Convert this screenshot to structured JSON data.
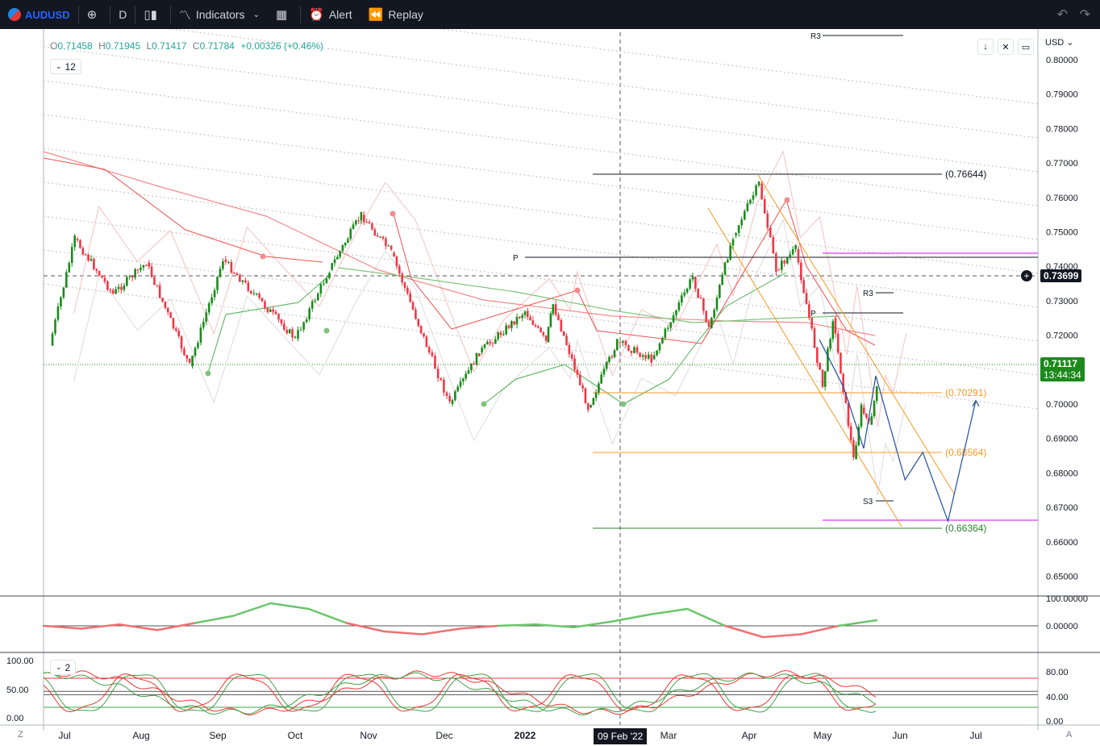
{
  "toolbar": {
    "symbol": "AUDUSD",
    "timeframe": "D",
    "indicators_label": "Indicators",
    "alert_label": "Alert",
    "replay_label": "Replay"
  },
  "legend": {
    "o_label": "O",
    "o": "0.71458",
    "h_label": "H",
    "h": "0.71945",
    "l_label": "L",
    "l": "0.71417",
    "c_label": "C",
    "c": "0.71784",
    "change": "+0.00326 (+0.46%)",
    "main_indicator_count": "12",
    "lower_indicator_count": "2"
  },
  "axis": {
    "currency": "USD",
    "price_ticks": [
      "0.80000",
      "0.79000",
      "0.78000",
      "0.77000",
      "0.76000",
      "0.75000",
      "0.74000",
      "0.73000",
      "0.72000",
      "0.71000",
      "0.70000",
      "0.69000",
      "0.68000",
      "0.67000",
      "0.66000",
      "0.65000"
    ],
    "osc1_ticks": [
      "100.00000",
      "0.00000"
    ],
    "osc2_right_ticks": [
      "80.00",
      "40.00",
      "0.00"
    ],
    "osc2_left_ticks": [
      "100.00",
      "50.00",
      "0.00"
    ],
    "time_labels": [
      "Jul",
      "Aug",
      "Sep",
      "Oct",
      "Nov",
      "Dec",
      "2022",
      "Mar",
      "Apr",
      "May",
      "Jun",
      "Jul"
    ],
    "left_corner": "Z",
    "right_corner": "A"
  },
  "tags": {
    "crosshair_price": "0.73699",
    "last_price": "0.71117",
    "countdown": "13:44:34",
    "crosshair_date": "09 Feb '22"
  },
  "colors": {
    "up": "#26a69a",
    "up_candle": "#1b8a1b",
    "down": "#f23645",
    "toolbar": "#131722",
    "fib": "#f59a23",
    "pivot": "#131722",
    "channel": "#c0c0c0",
    "forecast": "#1f4e9c",
    "magenta": "#d500f9"
  },
  "chart_data": {
    "type": "candlestick",
    "symbol": "AUDUSD",
    "timeframe": "D",
    "ylim": [
      0.645,
      0.802
    ],
    "price_levels": [
      {
        "label": "(0.76644)",
        "value": 0.76644
      },
      {
        "label": "(0.70291)",
        "value": 0.70291
      },
      {
        "label": "(0.68564)",
        "value": 0.68564
      },
      {
        "label": "(0.66364)",
        "value": 0.66364
      }
    ],
    "pivot_labels": [
      "P",
      "R3",
      "S3"
    ],
    "swing_points": [
      {
        "date": "Jun 25",
        "price": 0.717
      },
      {
        "date": "Jul 5",
        "price": 0.748
      },
      {
        "date": "Jul 20",
        "price": 0.732
      },
      {
        "date": "Aug 3",
        "price": 0.741
      },
      {
        "date": "Aug 20",
        "price": 0.711
      },
      {
        "date": "Sep 3",
        "price": 0.742
      },
      {
        "date": "Sep 15",
        "price": 0.732
      },
      {
        "date": "Oct 1",
        "price": 0.719
      },
      {
        "date": "Oct 15",
        "price": 0.739
      },
      {
        "date": "Oct 28",
        "price": 0.755
      },
      {
        "date": "Nov 10",
        "price": 0.744
      },
      {
        "date": "Nov 25",
        "price": 0.715
      },
      {
        "date": "Dec 3",
        "price": 0.7
      },
      {
        "date": "Dec 14",
        "price": 0.715
      },
      {
        "date": "Dec 31",
        "price": 0.727
      },
      {
        "date": "Jan 10",
        "price": 0.718
      },
      {
        "date": "Jan 13",
        "price": 0.729
      },
      {
        "date": "Jan 28",
        "price": 0.699
      },
      {
        "date": "Feb 10",
        "price": 0.718
      },
      {
        "date": "Feb 24",
        "price": 0.713
      },
      {
        "date": "Mar 10",
        "price": 0.737
      },
      {
        "date": "Mar 16",
        "price": 0.722
      },
      {
        "date": "Mar 25",
        "price": 0.749
      },
      {
        "date": "Apr 5",
        "price": 0.764
      },
      {
        "date": "Apr 12",
        "price": 0.739
      },
      {
        "date": "Apr 20",
        "price": 0.745
      },
      {
        "date": "May 1",
        "price": 0.705
      },
      {
        "date": "May 5",
        "price": 0.725
      },
      {
        "date": "May 13",
        "price": 0.684
      },
      {
        "date": "May 16",
        "price": 0.699
      },
      {
        "date": "May 19",
        "price": 0.694
      },
      {
        "date": "May 24",
        "price": 0.7111
      }
    ],
    "forecast_path": [
      {
        "date": "May 24",
        "price": 0.711
      },
      {
        "date": "Jun 3",
        "price": 0.678
      },
      {
        "date": "Jun 10",
        "price": 0.686
      },
      {
        "date": "Jun 20",
        "price": 0.666
      },
      {
        "date": "Jul 1",
        "price": 0.701
      }
    ],
    "oscillator_1": {
      "ylim": [
        -50,
        100
      ],
      "values_approx": [
        0,
        -10,
        5,
        -15,
        10,
        35,
        80,
        60,
        10,
        -20,
        -30,
        -10,
        0,
        5,
        -5,
        15,
        40,
        60,
        0,
        -40,
        -30,
        0,
        20
      ]
    },
    "oscillator_2": {
      "ylim": [
        0,
        100
      ],
      "levels": [
        80,
        50,
        20
      ]
    }
  }
}
